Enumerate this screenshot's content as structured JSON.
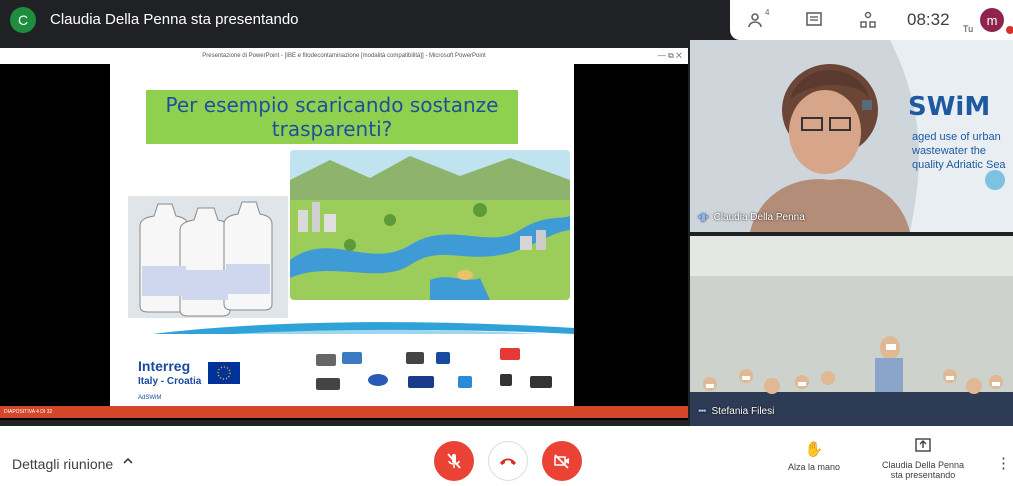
{
  "header": {
    "presenter_initial": "C",
    "title": "Claudia Della Penna sta presentando",
    "participants_count": "4",
    "time": "08:32",
    "self_label": "Tu",
    "self_initial": "m"
  },
  "presentation": {
    "window_title": "Presentazione di PowerPoint - [IBE e fitodecontaminazione [modalità compatibilità]] - Microsoft PowerPoint",
    "window_buttons": "—  ⧉  ✕",
    "slide_title": "Per esempio scaricando sostanze trasparenti?",
    "logo_text_1": "Interreg",
    "logo_text_2": "Italy - Croatia",
    "logo_text_3": "AdSWiM",
    "status_text": "DIAPOSITIVA 4 DI 32"
  },
  "participants": [
    {
      "name": "Claudia Della Penna",
      "banner_text": "SWiM",
      "banner_sub": "aged use of urban wastewater the quality Adriatic Sea"
    },
    {
      "name": "Stefania Filesi"
    }
  ],
  "controls": {
    "details_label": "Dettagli riunione",
    "raise_hand_label": "Alza la mano",
    "presenting_label_1": "Claudia Della Penna",
    "presenting_label_2": "sta presentando"
  },
  "colors": {
    "mic_off": "#ea4335",
    "slide_title_bg": "#8fd14f",
    "slide_title_fg": "#1f4e9c",
    "status_bar": "#d2462a"
  }
}
